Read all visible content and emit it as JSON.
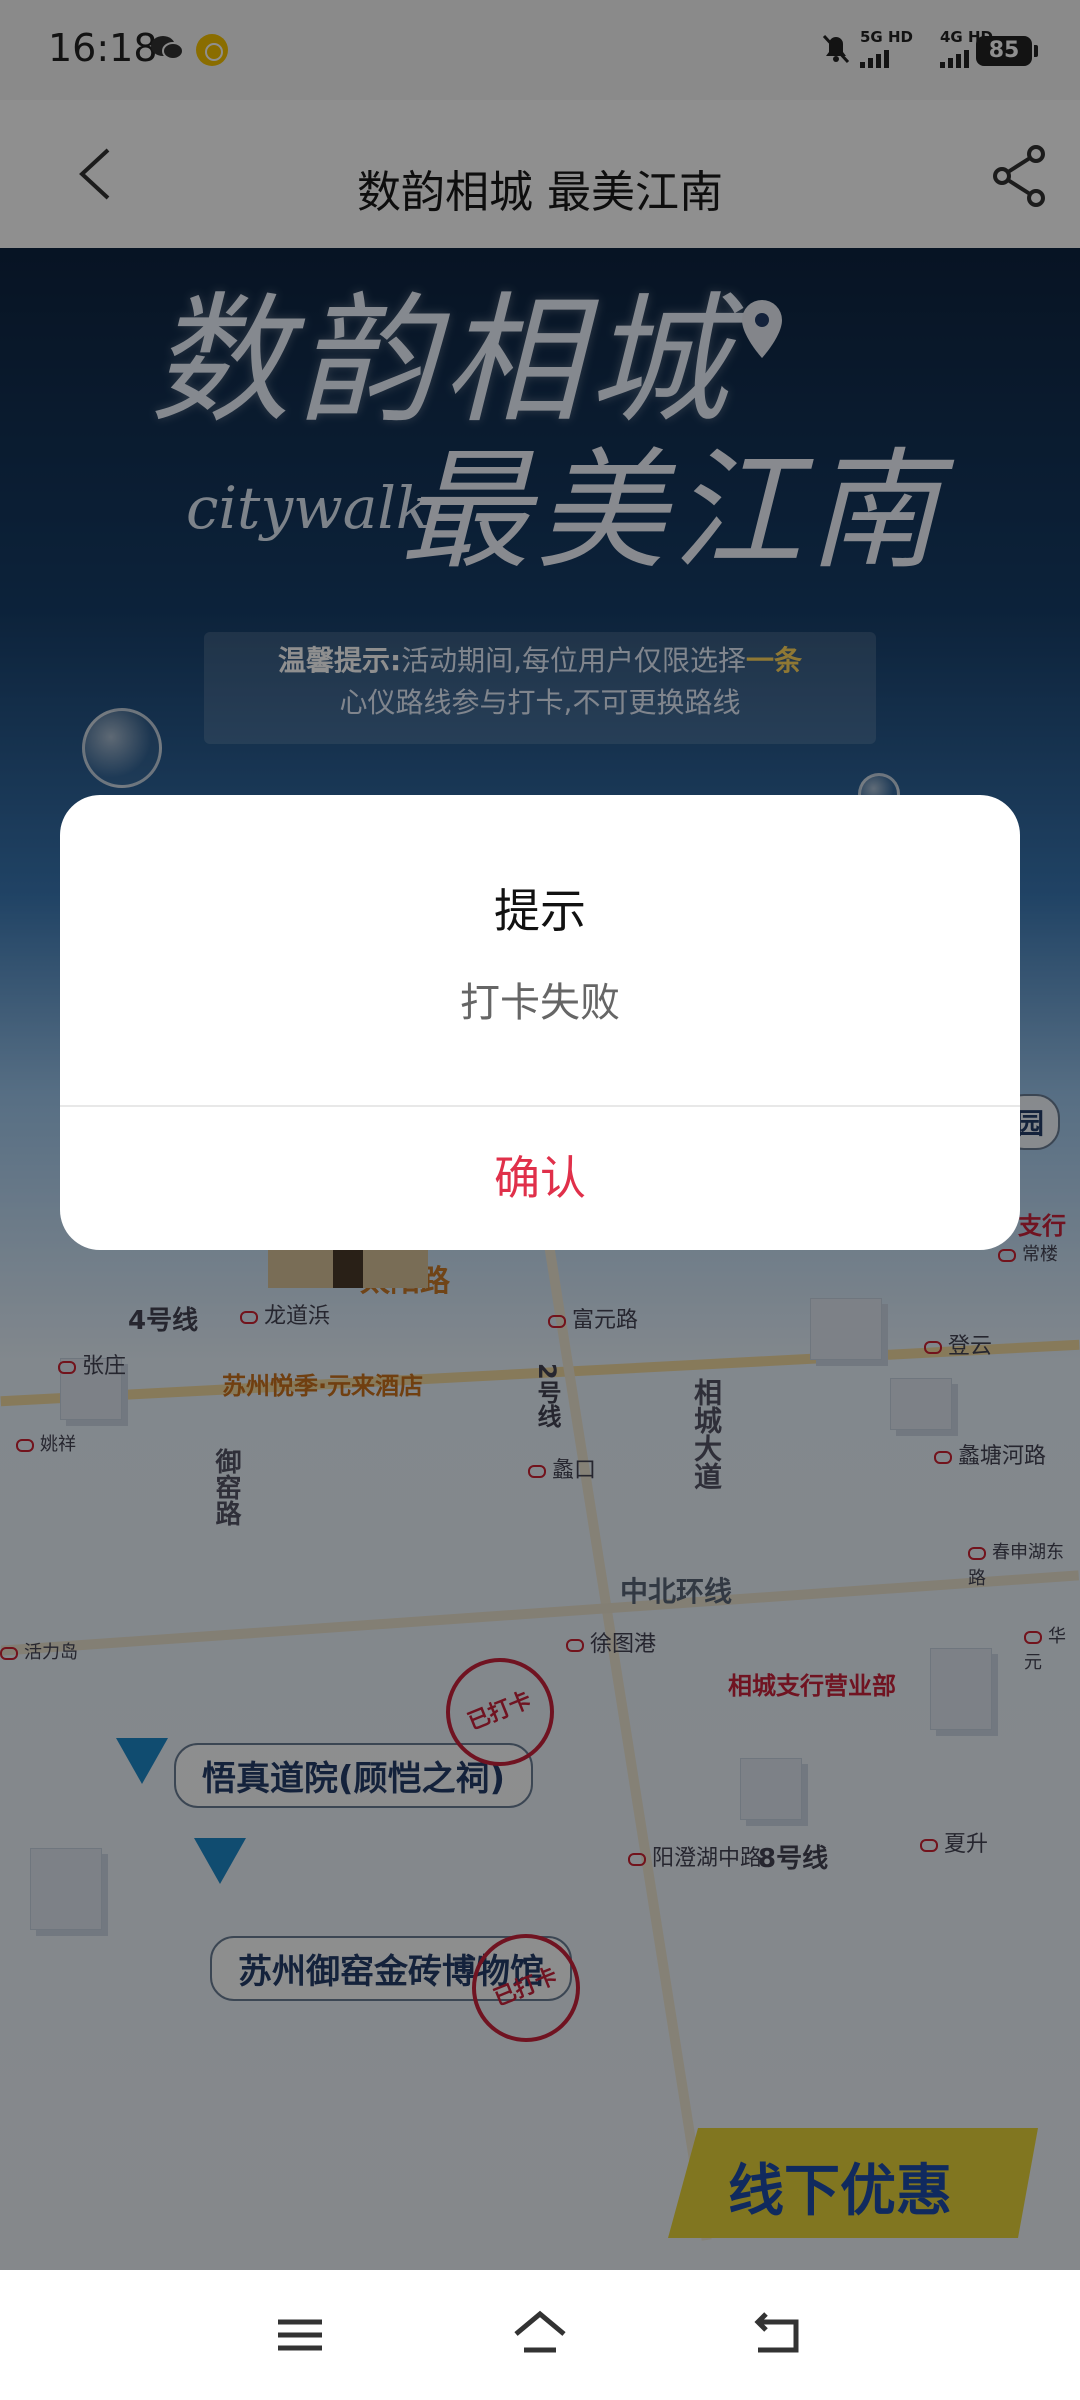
{
  "status_bar": {
    "time": "16:18",
    "signal1_label": "5G HD",
    "signal2_label": "4G HD",
    "battery": "85",
    "icons": [
      "wechat-icon",
      "coin-icon",
      "mute-icon",
      "signal-icon",
      "battery-icon"
    ]
  },
  "header": {
    "title": "数韵相城 最美江南",
    "back_icon": "chevron-left-icon",
    "share_icon": "share-icon"
  },
  "poster": {
    "headline_line1": "数韵相城",
    "headline_line2": "最美江南",
    "script_text": "citywalk",
    "tip_prefix": "温馨提示:",
    "tip_text_a": "活动期间,每位用户仅限选择",
    "tip_highlight": "一条",
    "tip_text_b": "心仪路线参与打卡,不可更换路线"
  },
  "map": {
    "streets": [
      "太阳路",
      "中北环线"
    ],
    "metro_lines": [
      "4号线",
      "2号线",
      "8号线"
    ],
    "vertical_road_labels": [
      "御窑路",
      "相城大道"
    ],
    "metro_stations": [
      "龙道浜",
      "富元路",
      "张庄",
      "蠡口",
      "徐图港",
      "阳澄湖中路",
      "夏升",
      "登云",
      "蠡塘河路",
      "春申湖东路",
      "华元",
      "活力岛",
      "姚祥",
      "常楼"
    ],
    "hotel": "苏州悦季·元来酒店",
    "bank_branch": "相城支行营业部",
    "bank_partial": "支行",
    "poi_1": "悟真道院(顾恺之祠)",
    "poi_2": "苏州御窑金砖博物馆",
    "stamp_label": "已打卡",
    "partial_pill": "园",
    "offline_banner": "线下优惠"
  },
  "dialog": {
    "title": "提示",
    "message": "打卡失败",
    "confirm_label": "确认"
  },
  "nav_bar": {
    "icons": [
      "menu-icon",
      "home-icon",
      "back-icon"
    ]
  },
  "colors": {
    "accent_red": "#e0304a",
    "overlay": "rgba(0,0,0,0.44)"
  }
}
